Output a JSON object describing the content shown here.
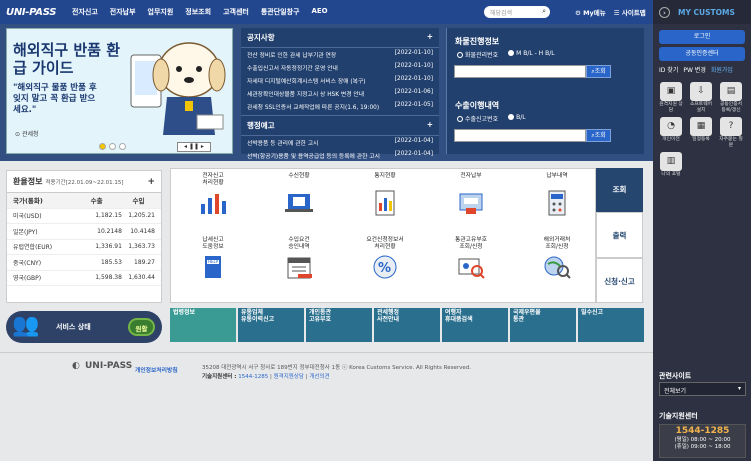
{
  "header": {
    "logo": "UNI-PASS",
    "nav": [
      "전자신고",
      "전자납부",
      "업무지원",
      "정보조회",
      "고객센터",
      "통관단일창구",
      "AEO"
    ],
    "search_placeholder": "해당검색",
    "my_menu": "My메뉴",
    "sitemap": "사이트맵"
  },
  "banner": {
    "title": "해외직구 반품 환급 가이드",
    "subtitle": "\"해외직구 물품 반품 후 잊지 말고 꼭 환급 받으세요.\"",
    "seal": "관세청",
    "page": "1 / 5"
  },
  "notice": {
    "title": "공지사항",
    "items": [
      {
        "text": "전산 정비로 인한 관세 납부기관 연장",
        "date": "[2022-01-10]"
      },
      {
        "text": "수출입신고서 자동정정기간 운영 안내",
        "date": "[2022-01-10]"
      },
      {
        "text": "자세대 디지털예산회계시스템 서비스 장애 (복구)",
        "date": "[2022-01-10]"
      },
      {
        "text": "세관장확인대상물품 지정고시 상 HSK 변경 안내",
        "date": "[2022-01-06]"
      },
      {
        "text": "관세청 SSL인증서 교체작업에 따른 공지(1.6, 19:00)",
        "date": "[2022-01-05]"
      }
    ]
  },
  "admin_notice": {
    "title": "행정예고",
    "items": [
      {
        "text": "선박용품 등 관리에 관한 고시",
        "date": "[2022-01-04]"
      },
      {
        "text": "선박(항공기)용품 및 용역공급업 등의 등록에 관한 고시",
        "date": "[2022-01-04]"
      }
    ]
  },
  "cargo": {
    "title": "화물진행정보",
    "radio1": "화물관리번호",
    "radio2": "M B/L - H B/L",
    "button": "조회"
  },
  "export": {
    "title": "수출이행내역",
    "radio1": "수출신고번호",
    "radio2": "B/L",
    "button": "조회"
  },
  "rates": {
    "title": "환율정보",
    "period": "적용기간[22.01.09~22.01.15]",
    "plus": "+",
    "headers": [
      "국가(통화)",
      "수출",
      "수입"
    ],
    "rows": [
      [
        "미국(USD)",
        "1,182.15",
        "1,205.21"
      ],
      [
        "일본(JPY)",
        "10.2148",
        "10.4148"
      ],
      [
        "유럽연합(EUR)",
        "1,336.91",
        "1,363.73"
      ],
      [
        "중국(CNY)",
        "185.53",
        "189.27"
      ],
      [
        "영국(GBP)",
        "1,598.38",
        "1,630.44"
      ]
    ]
  },
  "service": {
    "label": "서비스 상태",
    "status": "원활"
  },
  "grid": [
    [
      "전자신고",
      "처리현황"
    ],
    [
      "수신현황",
      ""
    ],
    [
      "통지현황",
      ""
    ],
    [
      "전자납부",
      ""
    ],
    [
      "납부내역",
      ""
    ],
    [
      "납세신고",
      "도움정보"
    ],
    [
      "수입요건",
      "승인내역"
    ],
    [
      "요건신청정보서",
      "처리현황"
    ],
    [
      "통관고유부호",
      "조회/신청"
    ],
    [
      "해외거래처",
      "조회/신청"
    ]
  ],
  "tabs": [
    "조회",
    "출력",
    "신청·신고"
  ],
  "strip": [
    "법령정보",
    "유통업체\n유통이력신고",
    "개인통관\n고유부호",
    "관세행정\n사전안내",
    "여행자\n휴대품검색",
    "국제우편물\n통관",
    "밀수신고"
  ],
  "footer": {
    "logo": "UNI-PASS",
    "privacy": "개인정보처리방침",
    "address": "35208 대전광역시 서구 청사로 189번지 정부대전청사 1동 ⓒ Korea Customs Service. All Rights Reserved.",
    "tech_label": "기술지원센터 :",
    "tech_phone": "1544-1285",
    "remote": "원격지원상담",
    "opinion": "개선의견"
  },
  "right": {
    "title": "MY CUSTOMS",
    "login": "로그인",
    "cert": "공동인증센터",
    "links": [
      "ID 찾기",
      "PW 변경",
      "회원가입"
    ],
    "icons": [
      "원격지원 상담",
      "소프트웨어 설치",
      "공동인증서 등록/갱신",
      "개인이전",
      "일정등록",
      "자주묻는 질문",
      "나의 포털"
    ],
    "related": "관련사이트",
    "select": "전체보기",
    "support": "기술지원센터",
    "phone": "1544-1285",
    "hours1": "(평일) 08:00 ~ 20:00",
    "hours2": "(휴일) 09:00 ~ 18:00"
  }
}
